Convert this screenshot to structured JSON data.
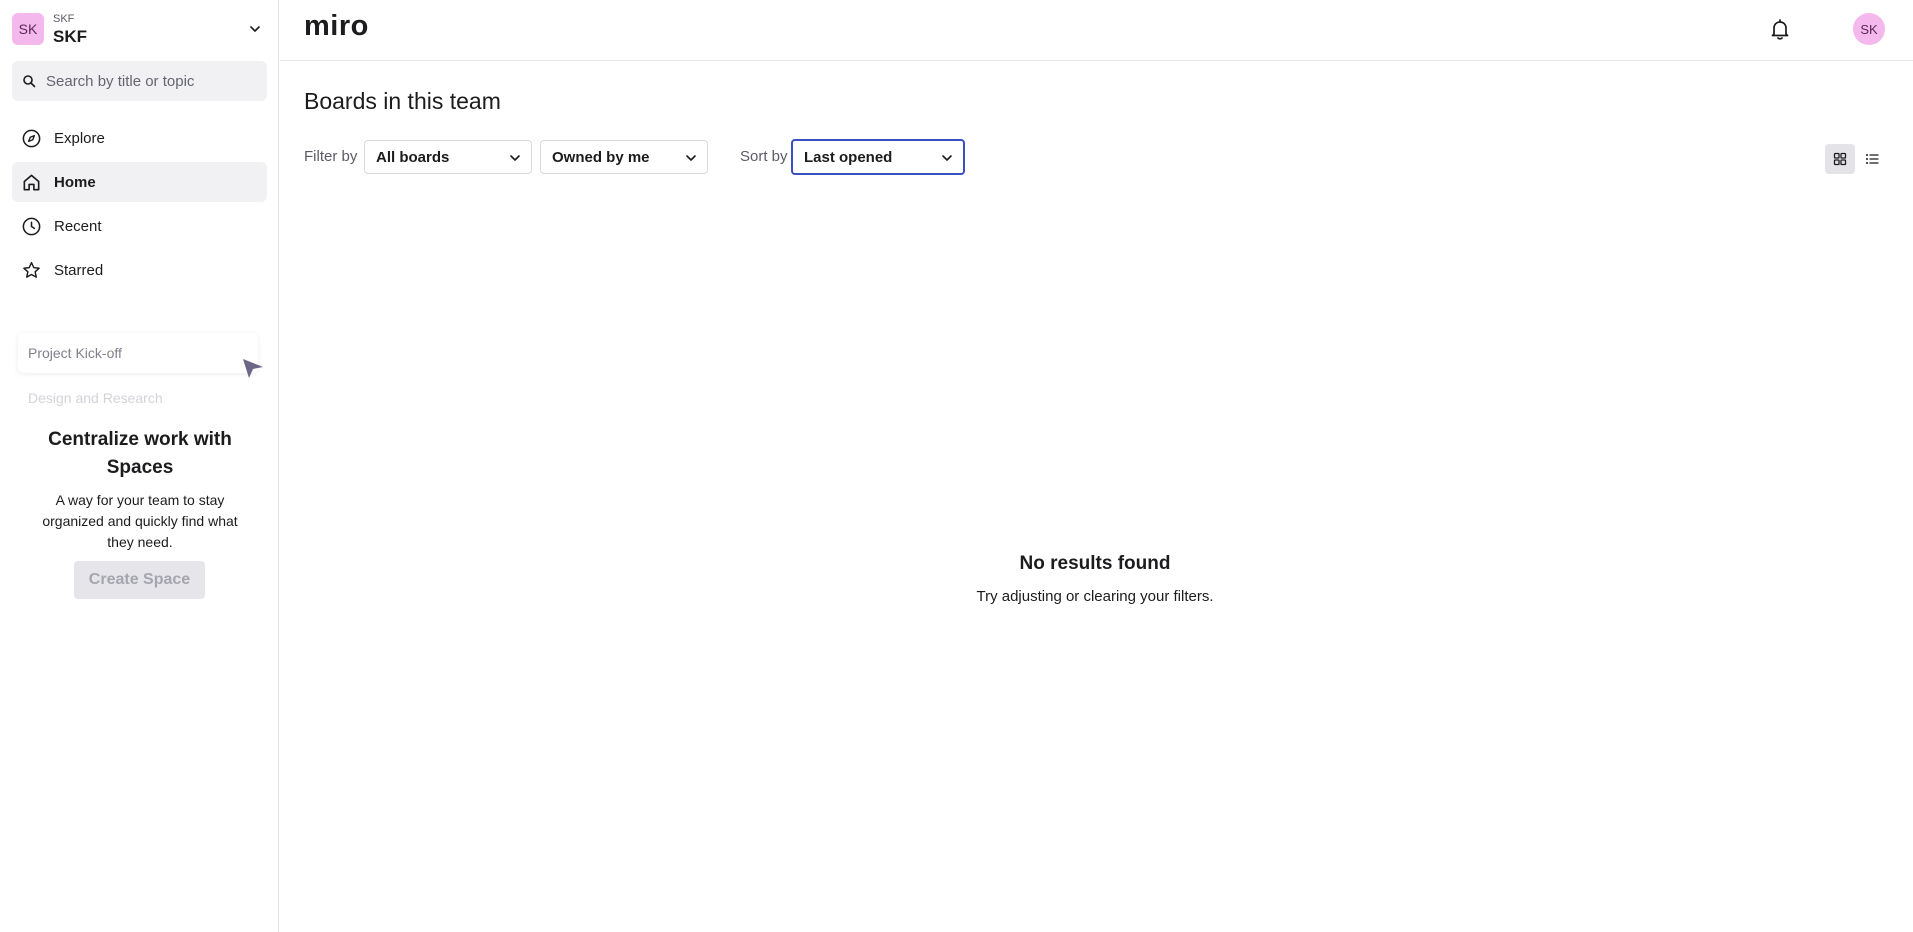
{
  "sidebar": {
    "team": {
      "avatar": "SK",
      "org": "SKF",
      "name": "SKF"
    },
    "search": {
      "placeholder": "Search by title or topic"
    },
    "nav": [
      {
        "label": "Explore",
        "icon": "compass-icon",
        "active": false
      },
      {
        "label": "Home",
        "icon": "home-icon",
        "active": true
      },
      {
        "label": "Recent",
        "icon": "clock-icon",
        "active": false
      },
      {
        "label": "Starred",
        "icon": "star-icon",
        "active": false
      }
    ],
    "promo": {
      "card_label": "Project Kick-off",
      "faded_label": "Design and Research",
      "title": "Centralize work with Spaces",
      "text": "A way for your team to stay organized and quickly find what they need.",
      "button": "Create Space"
    }
  },
  "topbar": {
    "logo": "miro",
    "user_avatar": "SK"
  },
  "main": {
    "title": "Boards in this team",
    "filter_label": "Filter by",
    "filter_boards": "All boards",
    "filter_owner": "Owned by me",
    "sort_label": "Sort by",
    "sort_value": "Last opened",
    "view_mode": "grid",
    "empty_title": "No results found",
    "empty_subtitle": "Try adjusting or clearing your filters."
  },
  "colors": {
    "accent_focus": "#3a4fc2",
    "avatar_bg": "#f5b8ec"
  }
}
